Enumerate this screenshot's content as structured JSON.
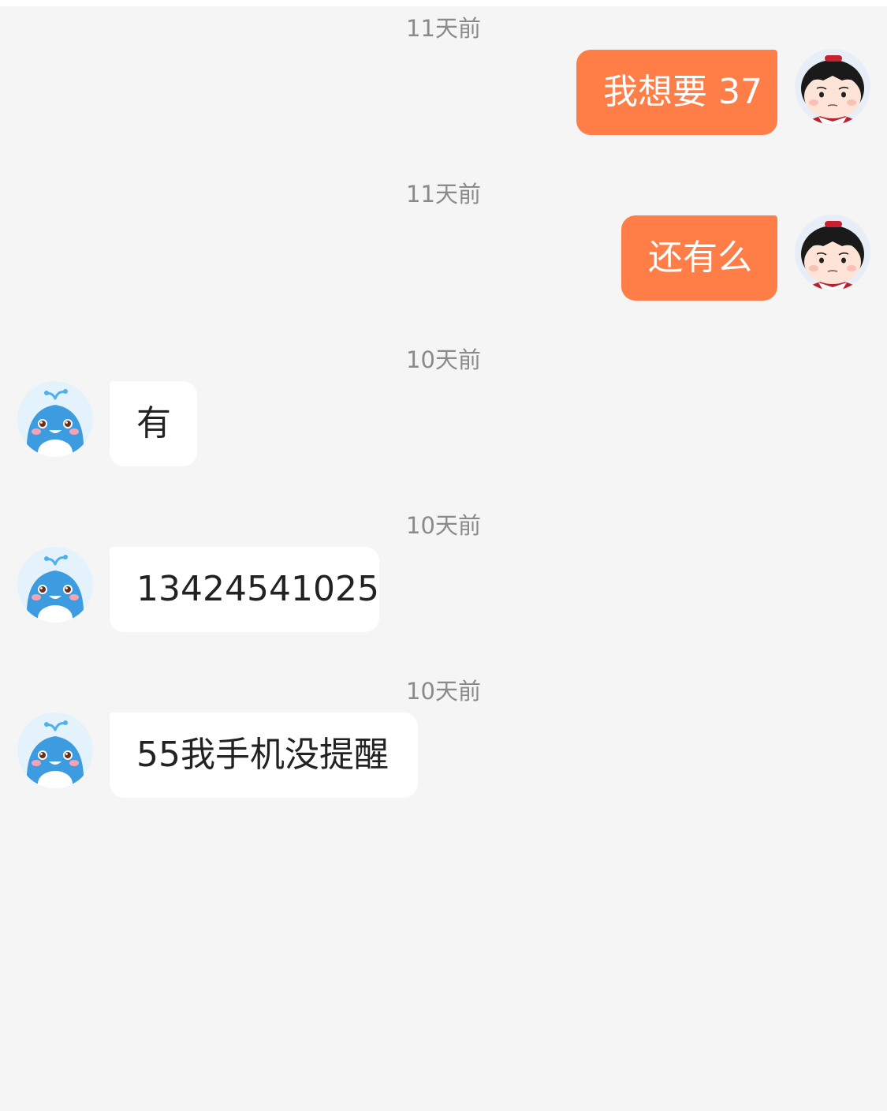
{
  "colors": {
    "background": "#f5f5f5",
    "outgoing_bubble": "#ff7e48",
    "incoming_bubble": "#ffffff",
    "timestamp": "#8a8a8a"
  },
  "messages": [
    {
      "timestamp": "11天前",
      "direction": "outgoing",
      "text": "我想要 37",
      "avatar": "girl-avatar-icon"
    },
    {
      "timestamp": "11天前",
      "direction": "outgoing",
      "text": "还有么",
      "avatar": "girl-avatar-icon"
    },
    {
      "timestamp": "10天前",
      "direction": "incoming",
      "text": "有",
      "avatar": "whale-avatar-icon"
    },
    {
      "timestamp": "10天前",
      "direction": "incoming",
      "text": "13424541025",
      "avatar": "whale-avatar-icon"
    },
    {
      "timestamp": "10天前",
      "direction": "incoming",
      "text": "55我手机没提醒",
      "avatar": "whale-avatar-icon"
    }
  ]
}
